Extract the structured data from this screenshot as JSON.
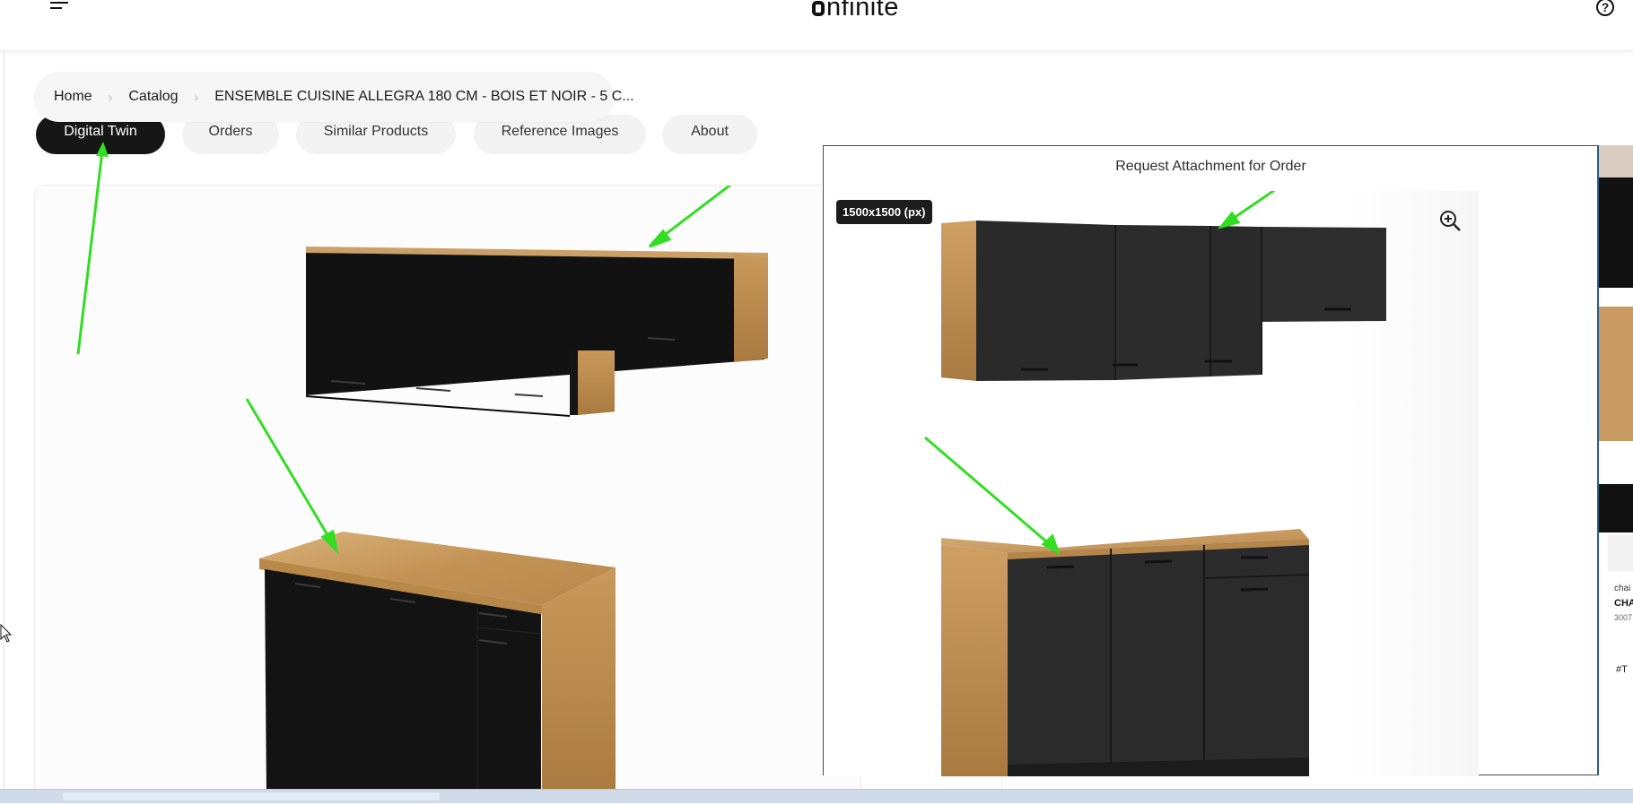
{
  "header": {
    "logo_text": "nfinite",
    "menu_icon": "hamburger-menu-icon",
    "help_icon": "help-circle-icon",
    "help_glyph": "?"
  },
  "breadcrumb": {
    "home": "Home",
    "catalog": "Catalog",
    "product": "ENSEMBLE CUISINE ALLEGRA 180 CM - BOIS ET NOIR - 5 C..."
  },
  "tabs": [
    {
      "label": "Digital Twin",
      "active": true
    },
    {
      "label": "Orders",
      "active": false
    },
    {
      "label": "Similar Products",
      "active": false
    },
    {
      "label": "Reference Images",
      "active": false
    },
    {
      "label": "About",
      "active": false
    }
  ],
  "modal": {
    "title": "Request Attachment for Order",
    "size_badge": "1500x1500 (px)",
    "zoom_icon": "zoom-in-icon"
  },
  "right_panel": {
    "text1": "chai",
    "text2": "CHA",
    "text3": "3007",
    "tag": "#T"
  },
  "colors": {
    "annotation_arrow": "#33dd22",
    "cabinet_black": "#141414",
    "cabinet_dark": "#2b2b2b",
    "wood": "#caa066",
    "active_tab": "#161616",
    "accent_border": "#2c5b87"
  }
}
